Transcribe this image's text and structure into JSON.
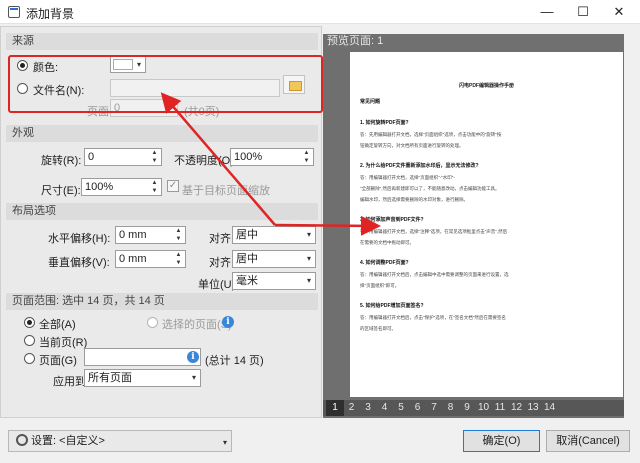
{
  "window": {
    "title": "添加背景",
    "min_glyph": "—",
    "max_glyph": "☐",
    "close_glyph": "✕"
  },
  "source": {
    "header": "来源",
    "color_label": "颜色:",
    "file_label": "文件名(N):",
    "page_label": "页面:",
    "page_value": "0",
    "page_total": "(共0页)"
  },
  "appearance": {
    "header": "外观",
    "rotation_label": "旋转(R):",
    "rotation_value": "0",
    "opacity_label": "不透明度(O):",
    "opacity_value": "100%",
    "size_label": "尺寸(E):",
    "size_value": "100%",
    "scale_checkbox_label": "基于目标页面缩放"
  },
  "layout": {
    "header": "布局选项",
    "h_offset_label": "水平偏移(H):",
    "h_offset_value": "0 mm",
    "v_offset_label": "垂直偏移(V):",
    "v_offset_value": "0 mm",
    "align1_label": "对齐:",
    "align1_value": "居中",
    "align2_label": "对齐:",
    "align2_value": "居中",
    "unit_label": "单位(U):",
    "unit_value": "毫米"
  },
  "range": {
    "header": "页面范围: 选中 14 页，共 14 页",
    "all_label": "全部(A)",
    "selected_label": "选择的页面(S)",
    "current_label": "当前页(R)",
    "pages_label": "页面(G)",
    "total_text": "(总计 14 页)",
    "apply_label": "应用到:",
    "apply_value": "所有页面"
  },
  "preview": {
    "header": "预览页面: 1",
    "pages": [
      "1",
      "2",
      "3",
      "4",
      "5",
      "6",
      "7",
      "8",
      "9",
      "10",
      "11",
      "12",
      "13",
      "14"
    ],
    "doc": {
      "title": "闪电PDF编辑器操作手册",
      "lines": [
        {
          "text": "常见问题",
          "q": true
        },
        {
          "text": "1. 如何旋转PDF页面?",
          "q": true
        },
        {
          "text": "答：先用编辑器打开文档，选择\"页面组织\"选项，点击功能中的\"旋转\"按",
          "q": false
        },
        {
          "text": "钮确定旋转方向，对文档所有页面进行旋转的处理。",
          "q": false
        },
        {
          "text": "2. 为什么给PDF文件重新添加水印后，显示无法修改?",
          "q": true
        },
        {
          "text": "答：用编辑器打开文档，选择\"页面组织\"-\"水印\"-",
          "q": false
        },
        {
          "text": "\"全部删除\",然后再新建即可以了，不能随意改动，点击编辑功能工具。",
          "q": false
        },
        {
          "text": "编辑水印，然后选择需要删除的水印对象，进行删除。",
          "q": false
        },
        {
          "text": "3. 如何添加声音到PDF文件?",
          "q": true
        },
        {
          "text": "答：用编辑器打开文档，选择\"注释\"选项，在常见选项框里点击\"声音\",然后",
          "q": false
        },
        {
          "text": "在需要的文档中拖动即可。",
          "q": false
        },
        {
          "text": "4. 如何调整PDF页面?",
          "q": true
        },
        {
          "text": "答：用编辑器打开文档后，点击编辑中选中需要调整的页面来进行设置，选",
          "q": false
        },
        {
          "text": "择\"页面组织\"即可。",
          "q": false
        },
        {
          "text": "5. 如何给PDF增加页面签名?",
          "q": true
        },
        {
          "text": "答：用编辑器打开文档后，点击\"保护\"选项，在\"签名文档\"然后在需要签名",
          "q": false
        },
        {
          "text": "的区域签名即可。",
          "q": false
        }
      ]
    }
  },
  "footer": {
    "settings_label": "设置: <自定义>",
    "ok_label": "确定(O)",
    "cancel_label": "取消(Cancel)"
  },
  "colors": {
    "annotation_red": "#e02424",
    "accent_blue": "#1c7cd6"
  }
}
